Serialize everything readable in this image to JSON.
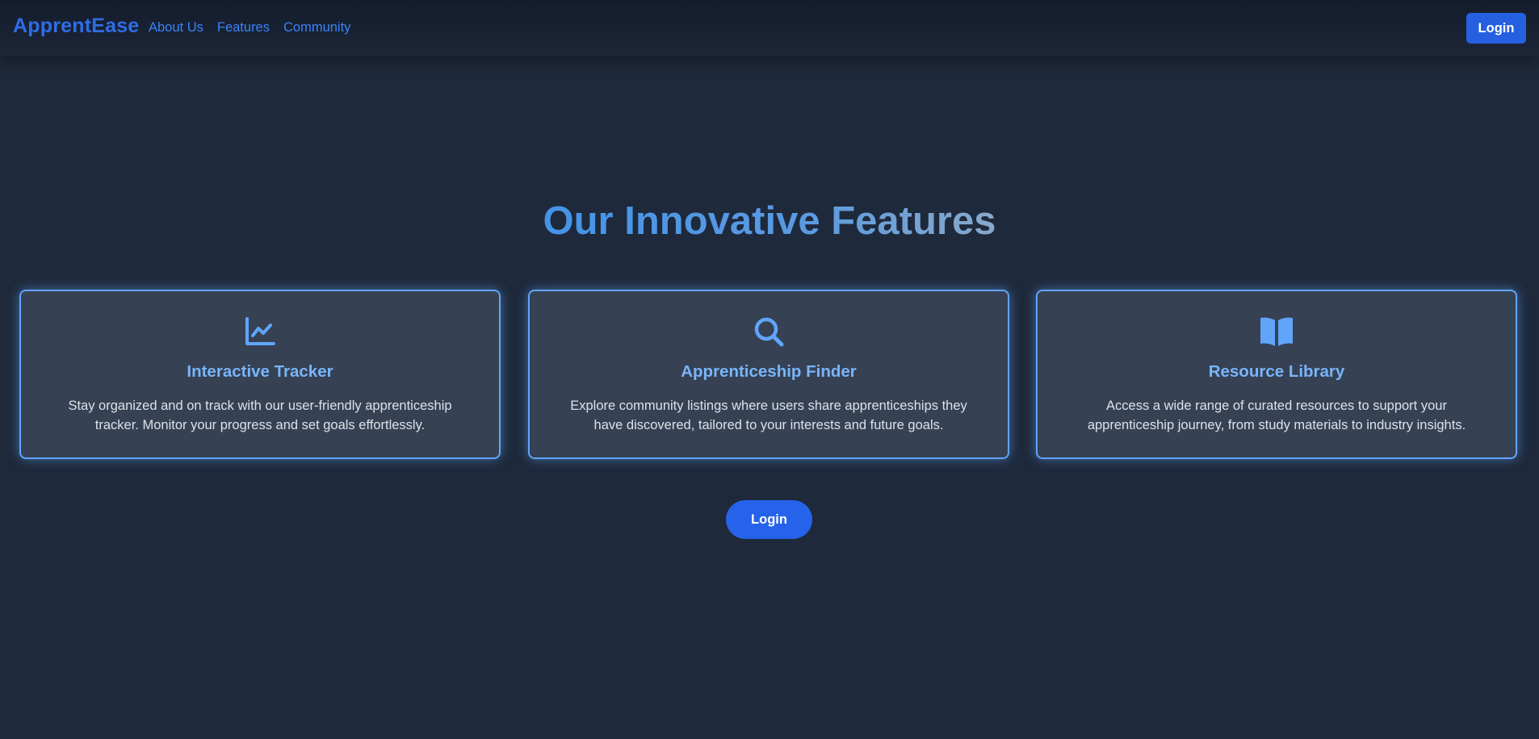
{
  "nav": {
    "brand": "ApprentEase",
    "links": [
      "About Us",
      "Features",
      "Community"
    ],
    "login_label": "Login"
  },
  "hero": {
    "title": "Our Innovative Features"
  },
  "features": [
    {
      "icon": "chart-line-icon",
      "title": "Interactive Tracker",
      "text": "Stay organized and on track with our user-friendly apprenticeship tracker. Monitor your progress and set goals effortlessly."
    },
    {
      "icon": "search-icon",
      "title": "Apprenticeship Finder",
      "text": "Explore community listings where users share apprenticeships they have discovered, tailored to your interests and future goals."
    },
    {
      "icon": "book-open-icon",
      "title": "Resource Library",
      "text": "Access a wide range of curated resources to support your apprenticeship journey, from study materials to industry insights."
    }
  ],
  "cta": {
    "login_label": "Login"
  },
  "colors": {
    "background": "#1e293b",
    "accent": "#2563eb",
    "card_border": "#60a5fa",
    "card_title": "#79b5f8"
  }
}
